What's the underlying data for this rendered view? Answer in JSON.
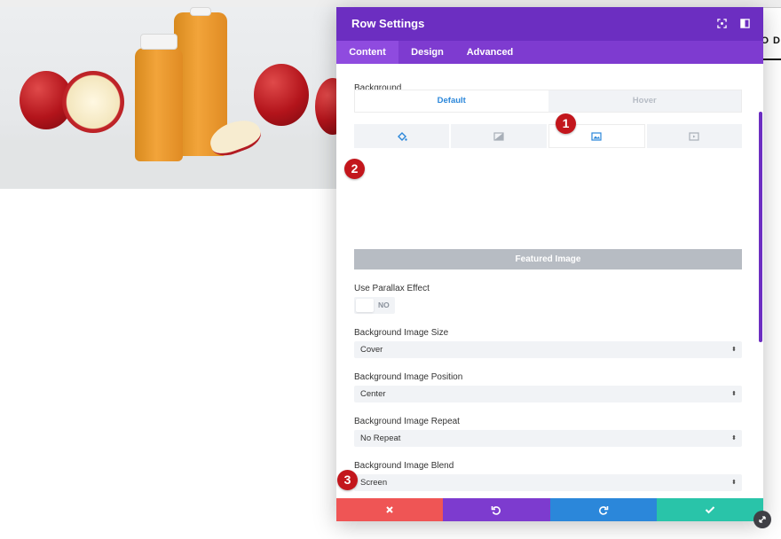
{
  "page": {
    "right_edge_text": "O D"
  },
  "modal": {
    "title": "Row Settings",
    "header_icons": [
      "fullscreen-icon",
      "sidebar-icon"
    ],
    "tabs": [
      {
        "label": "Content",
        "active": true
      },
      {
        "label": "Design",
        "active": false
      },
      {
        "label": "Advanced",
        "active": false
      }
    ],
    "background": {
      "label": "Background",
      "modes": [
        {
          "label": "Default",
          "active": true
        },
        {
          "label": "Hover",
          "active": false
        }
      ],
      "type_tabs": [
        "paint-bucket-icon",
        "gradient-icon",
        "image-icon",
        "video-icon"
      ],
      "active_type": "image-icon",
      "featured_image_label": "Featured Image"
    },
    "parallax": {
      "label": "Use Parallax Effect",
      "value": "NO"
    },
    "fields": [
      {
        "label": "Background Image Size",
        "value": "Cover"
      },
      {
        "label": "Background Image Position",
        "value": "Center"
      },
      {
        "label": "Background Image Repeat",
        "value": "No Repeat"
      },
      {
        "label": "Background Image Blend",
        "value": "Screen"
      }
    ],
    "footer_buttons": [
      {
        "name": "discard",
        "icon": "close-icon",
        "color": "#ef5555"
      },
      {
        "name": "undo",
        "icon": "undo-icon",
        "color": "#7d3bcf"
      },
      {
        "name": "redo",
        "icon": "redo-icon",
        "color": "#2b87da"
      },
      {
        "name": "save",
        "icon": "check-icon",
        "color": "#29c4a9"
      }
    ]
  },
  "annotations": [
    "1",
    "2",
    "3"
  ],
  "colors": {
    "header": "#6c2ec1",
    "tabs": "#7e3bd0",
    "active_tab": "#8f4bdf",
    "accent_blue": "#2b87da",
    "badge_red": "#c3161c"
  }
}
